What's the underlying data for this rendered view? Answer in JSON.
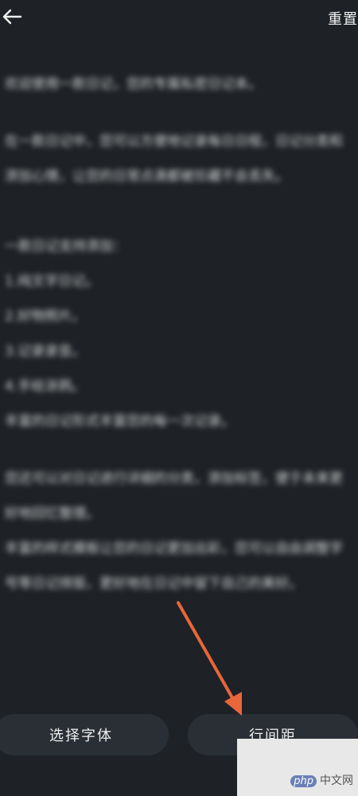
{
  "header": {
    "back_icon": "back-arrow-icon",
    "reset_label": "重置"
  },
  "content": {
    "paragraphs": [
      "欢迎使用一款日记，您的专属私密日记本。",
      "在一款日记中，您可以方便地记录每日日程，日记分类和添加心情，让您的日常点滴都被珍藏不会丢失。",
      "一款日记支持添加：",
      "1.纯文字日记。",
      "2.好物照片。",
      "3.记录录音。",
      "4.手绘涂鸦。",
      "丰富的日记形式丰富您的每一次记录。",
      "您还可以对日记进行详细的分类，添加标签，便于未来更好地回忆整理。",
      "丰富的样式模板让您的日记更加出彩，您可以自由调整字号等日记排版，更好地在日记中留下自己的美好。"
    ]
  },
  "bottom_bar": {
    "font_label": "选择字体",
    "spacing_label": "行间距"
  },
  "annotation": {
    "arrow_color": "#e8663a"
  },
  "watermark": {
    "php": "php",
    "cn": "中文网"
  }
}
